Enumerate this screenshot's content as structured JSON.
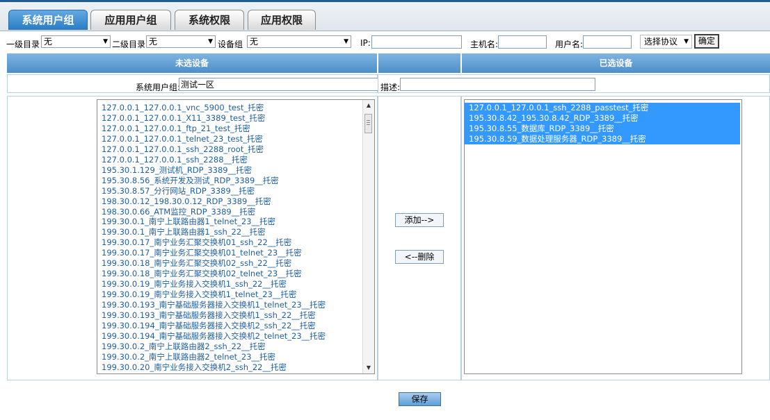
{
  "tabs": [
    {
      "label": "系统用户组",
      "active": true
    },
    {
      "label": "应用用户组",
      "active": false
    },
    {
      "label": "系统权限",
      "active": false
    },
    {
      "label": "应用权限",
      "active": false
    }
  ],
  "filters": {
    "level1_label": "一级目录",
    "level1_value": "无",
    "level2_label": "二级目录",
    "level2_value": "无",
    "group_label": "设备组",
    "group_value": "无",
    "ip_label": "IP:",
    "ip_value": "",
    "host_label": "主机名:",
    "host_value": "",
    "user_label": "用户名:",
    "user_value": "",
    "protocol_value": "选择协议",
    "confirm_label": "确定"
  },
  "headers": {
    "unselected": "未选设备",
    "selected": "已选设备"
  },
  "group": {
    "label": "系统用户组:",
    "value": "测试一区",
    "desc_label": "描述:",
    "desc_value": ""
  },
  "unselected_devices": [
    "127.0.0.1_127.0.0.1_vnc_5900_test_托密",
    "127.0.0.1_127.0.0.1_X11_3389_test_托密",
    "127.0.0.1_127.0.0.1_ftp_21_test_托密",
    "127.0.0.1_127.0.0.1_telnet_23_test_托密",
    "127.0.0.1_127.0.0.1_ssh_2288_root_托密",
    "127.0.0.1_127.0.0.1_ssh_2288__托密",
    "195.30.1.129_测试机_RDP_3389__托密",
    "195.30.8.56_系统开发及测试_RDP_3389__托密",
    "195.30.8.57_分行网站_RDP_3389__托密",
    "198.30.0.12_198.30.0.12_RDP_3389__托密",
    "198.30.0.66_ATM监控_RDP_3389__托密",
    "199.30.0.1_南宁上联路由器1_telnet_23__托密",
    "199.30.0.1_南宁上联路由器1_ssh_22__托密",
    "199.30.0.17_南宁业务汇聚交换机01_ssh_22__托密",
    "199.30.0.17_南宁业务汇聚交换机01_telnet_23__托密",
    "199.30.0.18_南宁业务汇聚交换机02_ssh_22__托密",
    "199.30.0.18_南宁业务汇聚交换机02_telnet_23__托密",
    "199.30.0.19_南宁业务接入交换机1_ssh_22__托密",
    "199.30.0.19_南宁业务接入交换机1_telnet_23__托密",
    "199.30.0.193_南宁基础服务器接入交换机1_telnet_23__托密",
    "199.30.0.193_南宁基础服务器接入交换机1_ssh_22__托密",
    "199.30.0.194_南宁基础服务器接入交换机2_ssh_22__托密",
    "199.30.0.194_南宁基础服务器接入交换机2_telnet_23__托密",
    "199.30.0.2_南宁上联路由器2_ssh_22__托密",
    "199.30.0.2_南宁上联路由器2_telnet_23__托密",
    "199.30.0.20_南宁业务接入交换机2_ssh_22__托密"
  ],
  "selected_devices": [
    "127.0.0.1_127.0.0.1_ssh_2288_passtest_托密",
    "195.30.8.42_195.30.8.42_RDP_3389__托密",
    "195.30.8.55_数据库_RDP_3389__托密",
    "195.30.8.59_数据处理服务器_RDP_3389__托密"
  ],
  "actions": {
    "add_label": "添加-->",
    "remove_label": "<--删除",
    "save_label": "保存"
  }
}
